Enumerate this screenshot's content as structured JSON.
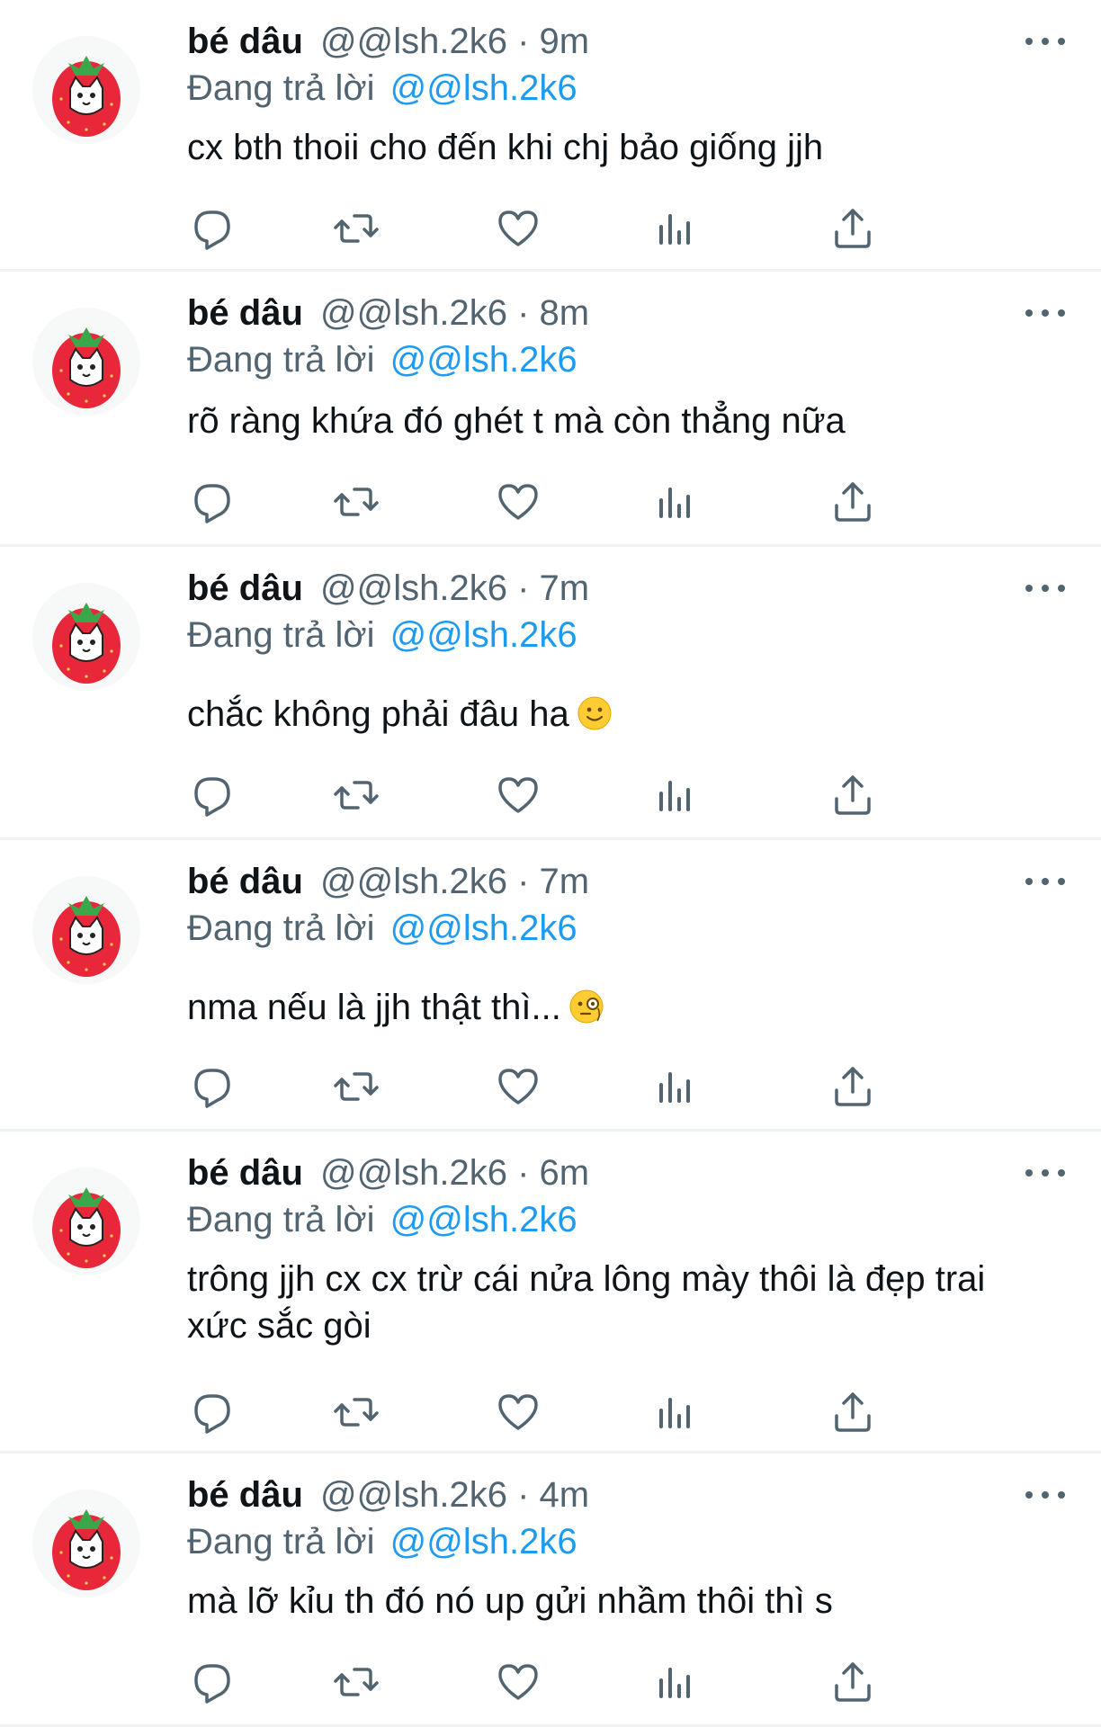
{
  "colors": {
    "text": "#0f1419",
    "secondary": "#536471",
    "link": "#1d9bf0",
    "divider": "#eff3f4",
    "avatar_red": "#e8283a"
  },
  "tweets": [
    {
      "display_name": "bé dâu",
      "handle_time": "@@lsh.2k6 · 9m",
      "reply_label": "Đang trả lời",
      "reply_handle": "@@lsh.2k6",
      "lines": [
        "cx bth thoii cho đến khi chj bảo giống jjh"
      ],
      "emoji": ""
    },
    {
      "display_name": "bé dâu",
      "handle_time": "@@lsh.2k6 · 8m",
      "reply_label": "Đang trả lời",
      "reply_handle": "@@lsh.2k6",
      "lines": [
        "rõ ràng khứa đó ghét t mà còn thẳng nữa"
      ],
      "emoji": ""
    },
    {
      "display_name": "bé dâu",
      "handle_time": "@@lsh.2k6 · 7m",
      "reply_label": "Đang trả lời",
      "reply_handle": "@@lsh.2k6",
      "lines": [
        "chắc không phải đâu ha"
      ],
      "emoji": "slightly-smiling-face"
    },
    {
      "display_name": "bé dâu",
      "handle_time": "@@lsh.2k6 · 7m",
      "reply_label": "Đang trả lời",
      "reply_handle": "@@lsh.2k6",
      "lines": [
        "nma nếu là jjh thật thì..."
      ],
      "emoji": "face-with-monocle"
    },
    {
      "display_name": "bé dâu",
      "handle_time": "@@lsh.2k6 · 6m",
      "reply_label": "Đang trả lời",
      "reply_handle": "@@lsh.2k6",
      "lines": [
        "trông jjh cx cx trừ cái nửa lông mày thôi là đẹp trai",
        "xức sắc gòi"
      ],
      "emoji": ""
    },
    {
      "display_name": "bé dâu",
      "handle_time": "@@lsh.2k6 · 4m",
      "reply_label": "Đang trả lời",
      "reply_handle": "@@lsh.2k6",
      "lines": [
        "mà lỡ kỉu th đó nó up gửi nhầm thôi thì s"
      ],
      "emoji": ""
    }
  ],
  "icons": {
    "avatar": "strawberry-cat-avatar",
    "more": "more-dots-icon",
    "reply": "reply-bubble-icon",
    "retweet": "retweet-icon",
    "like": "heart-icon",
    "views": "views-bar-chart-icon",
    "share": "share-upload-icon"
  }
}
